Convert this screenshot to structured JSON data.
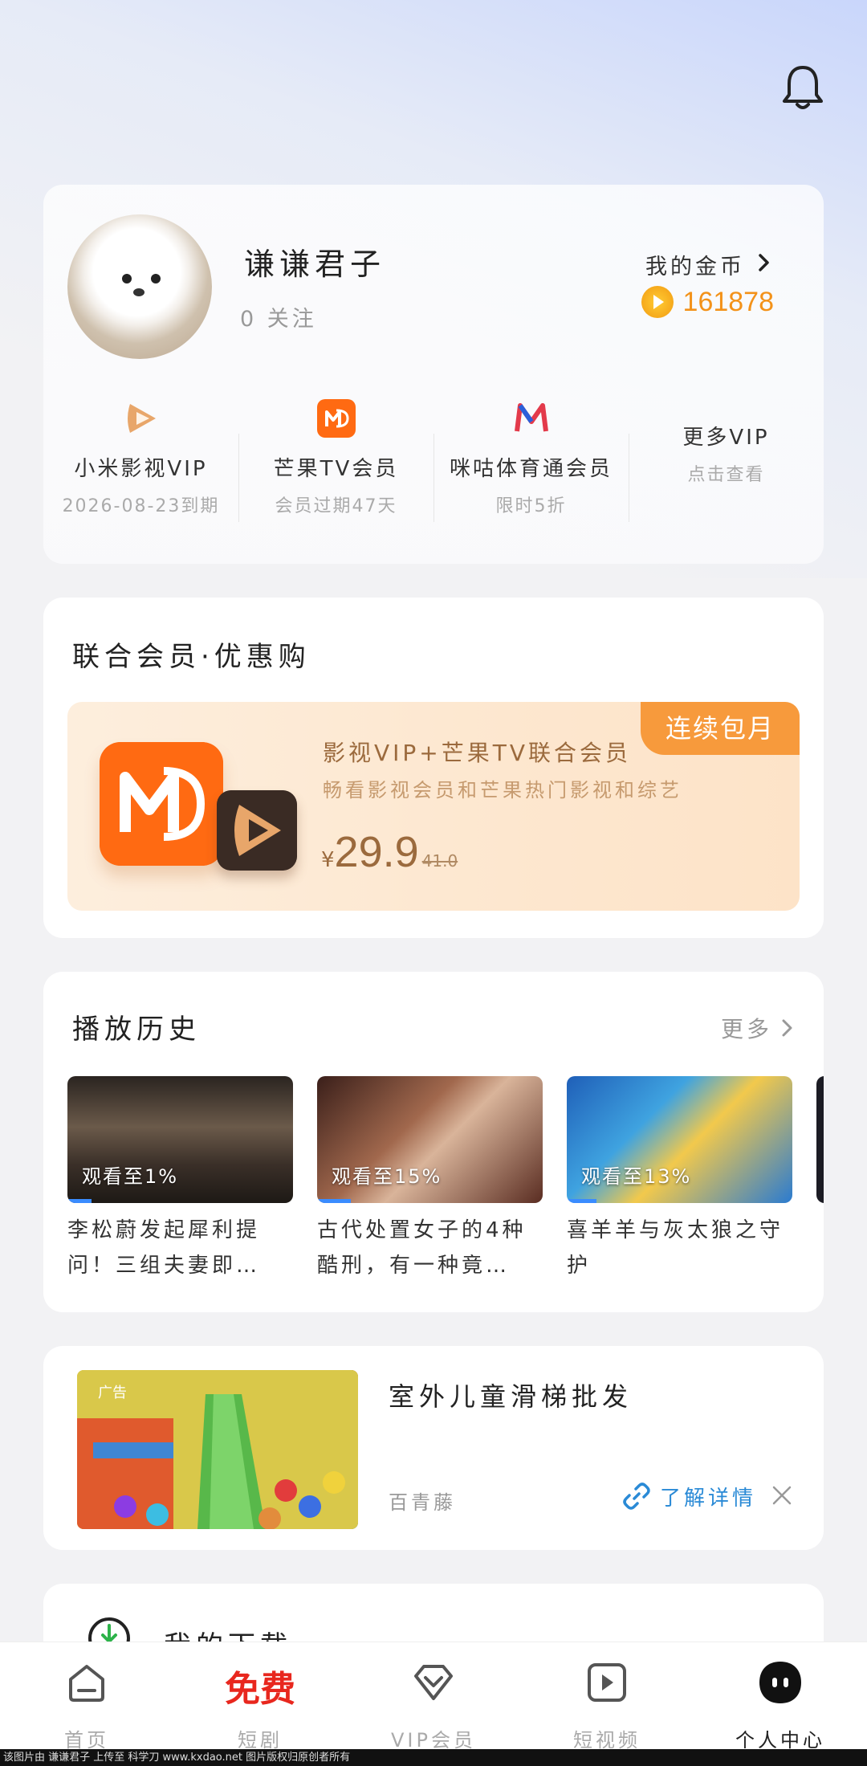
{
  "profile": {
    "username": "谦谦君子",
    "follow_text": "0 关注",
    "coins_label": "我的金币",
    "coins_value": "161878"
  },
  "vip_items": [
    {
      "title": "小米影视VIP",
      "sub": "2026-08-23到期",
      "icon": "xiaomi-video-icon",
      "color": "#e8a66a"
    },
    {
      "title": "芒果TV会员",
      "sub": "会员过期47天",
      "icon": "mango-tv-icon",
      "color": "#ff6a12"
    },
    {
      "title": "咪咕体育通会员",
      "sub": "限时5折",
      "icon": "migu-icon",
      "color": "#e33a4b"
    },
    {
      "title": "更多VIP",
      "sub": "点击查看",
      "icon": "",
      "color": ""
    }
  ],
  "promo": {
    "section_title": "联合会员·优惠购",
    "badge": "连续包月",
    "title": "影视VIP+芒果TV联合会员",
    "desc": "畅看影视会员和芒果热门影视和综艺",
    "currency": "¥",
    "price": "29.9",
    "old_price": "41.0"
  },
  "history": {
    "section_title": "播放历史",
    "more_label": "更多",
    "items": [
      {
        "progress_text": "观看至1%",
        "progress": 0.01,
        "title": "李松蔚发起犀利提问！三组夫妻即…"
      },
      {
        "progress_text": "观看至15%",
        "progress": 0.15,
        "title": "古代处置女子的4种酷刑，有一种竟…"
      },
      {
        "progress_text": "观看至13%",
        "progress": 0.13,
        "title": "喜羊羊与灰太狼之守护"
      }
    ]
  },
  "ad": {
    "tag": "广告",
    "title": "室外儿童滑梯批发",
    "source": "百青藤",
    "link_label": "了解详情"
  },
  "downloads": {
    "label": "我的下载"
  },
  "tabs": [
    {
      "label": "首页",
      "icon": "home-icon"
    },
    {
      "label": "短剧",
      "icon": "free-badge",
      "badge": "免费"
    },
    {
      "label": "VIP会员",
      "icon": "vip-diamond-icon"
    },
    {
      "label": "短视频",
      "icon": "play-square-icon"
    },
    {
      "label": "个人中心",
      "icon": "profile-icon"
    }
  ],
  "footer_text": "该图片由 谦谦君子 上传至 科学刀 www.kxdao.net 图片版权归原创者所有"
}
